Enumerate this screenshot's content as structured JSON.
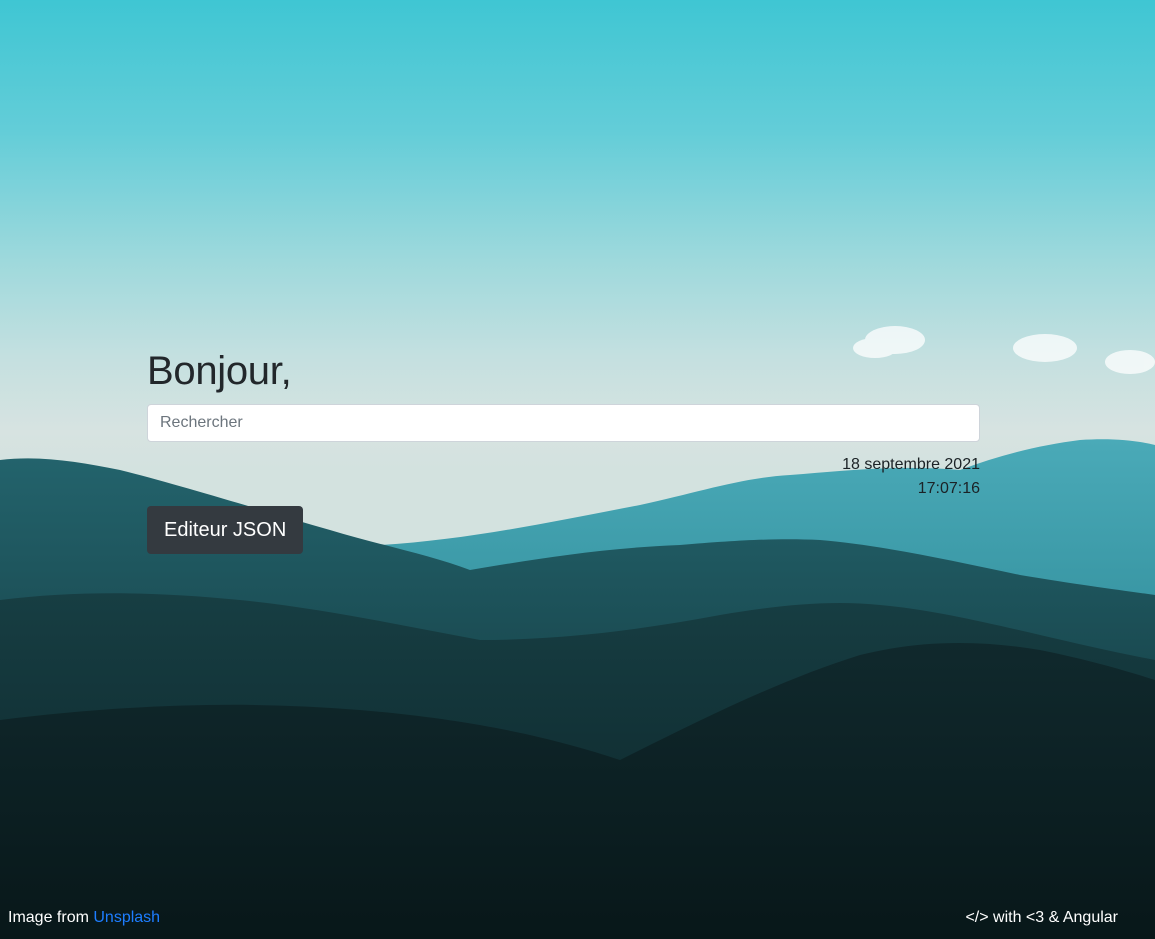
{
  "main": {
    "greeting": "Bonjour,",
    "search": {
      "placeholder": "Rechercher",
      "value": ""
    },
    "date": "18 septembre 2021",
    "time": "17:07:16",
    "json_editor_button": "Editeur JSON"
  },
  "footer": {
    "credit_prefix": "Image from ",
    "credit_link": "Unsplash",
    "made_with": "</> with <3 & Angular"
  },
  "colors": {
    "sky_top": "#3fc6d3",
    "sky_haze": "#d3e2df",
    "hills_far": "#3d9fae",
    "hills_mid": "#1d5e66",
    "hills_near": "#0d2b30",
    "button_bg": "#343a40",
    "link": "#1d7dff"
  }
}
